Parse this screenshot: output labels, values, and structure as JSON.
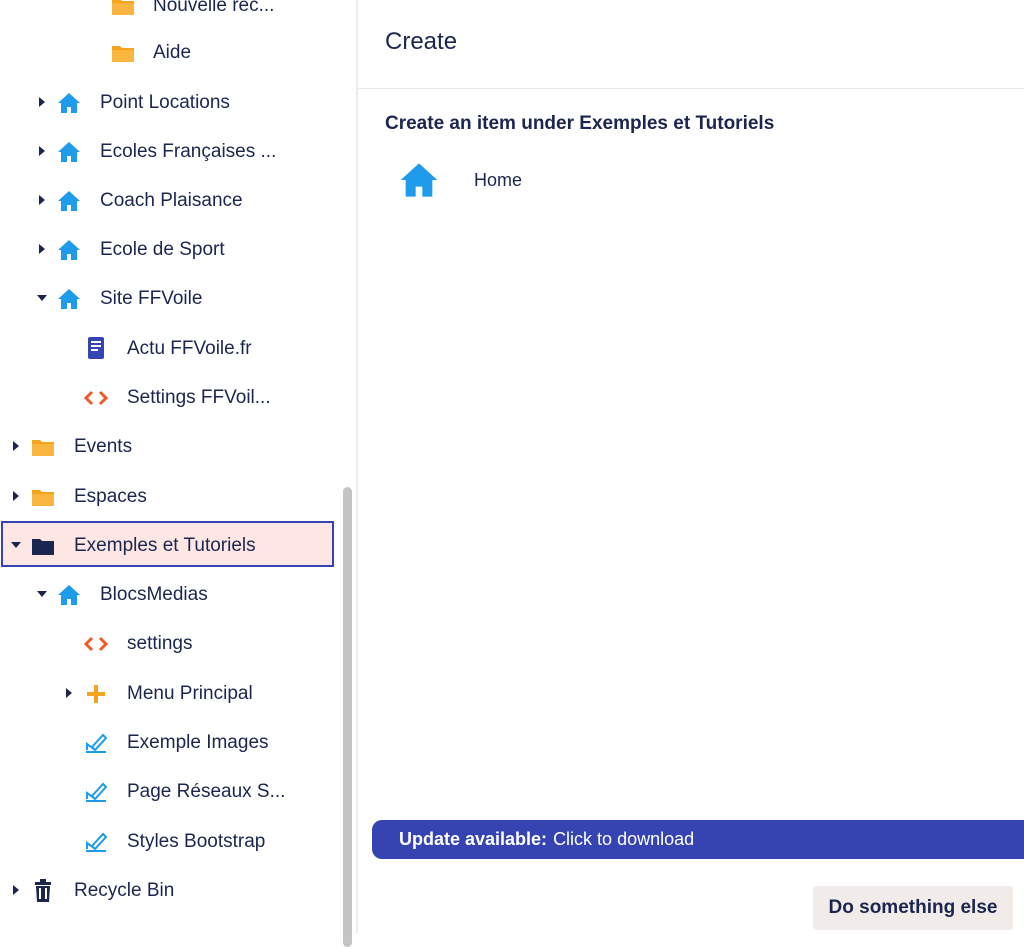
{
  "tree": {
    "items": [
      {
        "label": "Nouvelle rec...",
        "icon": "folder-icon"
      },
      {
        "label": "Aide",
        "icon": "folder-icon"
      },
      {
        "label": "Point Locations",
        "icon": "home-icon"
      },
      {
        "label": "Ecoles Françaises ...",
        "icon": "home-icon"
      },
      {
        "label": "Coach Plaisance",
        "icon": "home-icon"
      },
      {
        "label": "Ecole de Sport",
        "icon": "home-icon"
      },
      {
        "label": "Site FFVoile",
        "icon": "home-icon"
      },
      {
        "label": "Actu FFVoile.fr",
        "icon": "book-icon"
      },
      {
        "label": "Settings FFVoil...",
        "icon": "code-icon"
      },
      {
        "label": "Events",
        "icon": "folder-icon"
      },
      {
        "label": "Espaces",
        "icon": "folder-icon"
      },
      {
        "label": "Exemples et Tutoriels",
        "icon": "folder-open-icon"
      },
      {
        "label": "BlocsMedias",
        "icon": "home-icon"
      },
      {
        "label": "settings",
        "icon": "code-icon"
      },
      {
        "label": "Menu Principal",
        "icon": "plus-icon"
      },
      {
        "label": "Exemple Images",
        "icon": "edit-icon"
      },
      {
        "label": "Page Réseaux S...",
        "icon": "edit-icon"
      },
      {
        "label": "Styles Bootstrap",
        "icon": "edit-icon"
      },
      {
        "label": "Recycle Bin",
        "icon": "trash-icon"
      }
    ]
  },
  "panel": {
    "title": "Create",
    "subtitle": "Create an item under Exemples et Tutoriels",
    "create_items": [
      {
        "label": "Home",
        "icon": "home-icon"
      }
    ]
  },
  "update_bar": {
    "strong": "Update available:",
    "rest": "Click to download"
  },
  "footer": {
    "button_label": "Do something else"
  },
  "colors": {
    "accent": "#3544b1",
    "home_icon": "#1e9bea",
    "folder_icon": "#f7a41d",
    "code_icon": "#f05a28",
    "book_icon": "#3544b1",
    "selected_bg": "#fde6e4",
    "text": "#1b264f"
  }
}
